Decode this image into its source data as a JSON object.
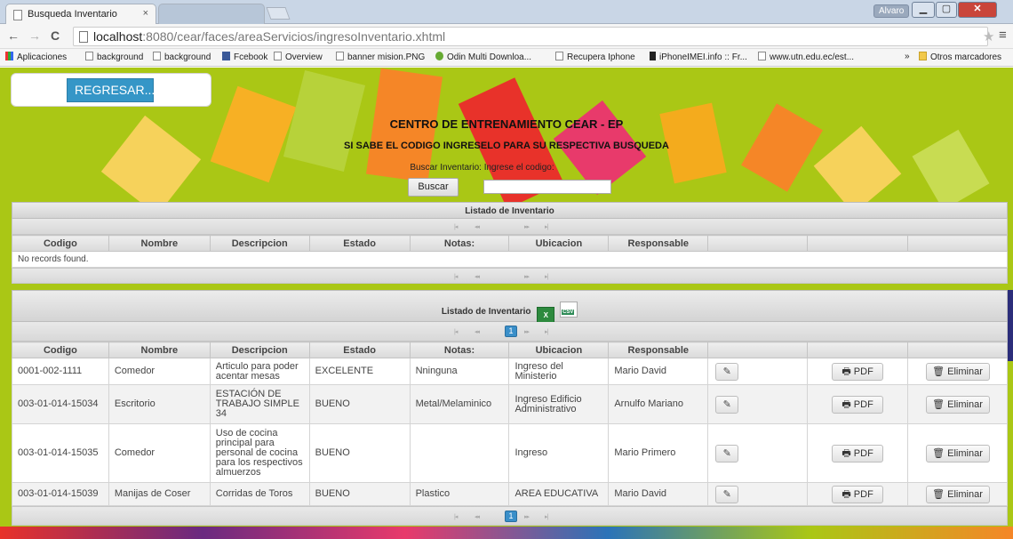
{
  "browser": {
    "tab_title": "Busqueda Inventario",
    "tab_close": "×",
    "user": "Alvaro",
    "url_host": "localhost",
    "url_path": ":8080/cear/faces/areaServicios/ingresoInventario.xhtml",
    "bookmarks": [
      "Aplicaciones",
      "background",
      "background",
      "Fcebook",
      "Overview",
      "banner mision.PNG",
      "Odin Multi Downloa...",
      "Recupera Iphone",
      "iPhoneIMEI.info :: Fr...",
      "www.utn.edu.ec/est..."
    ],
    "more_bookmarks": "»",
    "other_bookmarks": "Otros marcadores"
  },
  "page": {
    "back_button": "REGRESAR...",
    "title": "CENTRO DE ENTRENAMIENTO CEAR - EP",
    "subtitle": "SI SABE EL CODIGO INGRESELO PARA SU RESPECTIVA BUSQUEDA",
    "search_label": "Buscar Inventario: Ingrese el codigo:",
    "search_button": "Buscar",
    "search_value": ""
  },
  "pager": {
    "first": "|◂",
    "prev": "◂◂",
    "next": "▸▸",
    "last": "▸|",
    "page": "1"
  },
  "table1": {
    "title": "Listado de Inventario",
    "columns": [
      "Codigo",
      "Nombre",
      "Descripcion",
      "Estado",
      "Notas:",
      "Ubicacion",
      "Responsable",
      "",
      "",
      ""
    ],
    "empty": "No records found."
  },
  "table2": {
    "title": "Listado de Inventario",
    "export_xls": "X",
    "export_csv": "CSV",
    "columns": [
      "Codigo",
      "Nombre",
      "Descripcion",
      "Estado",
      "Notas:",
      "Ubicacion",
      "Responsable",
      "",
      "",
      ""
    ],
    "edit_icon": "✎",
    "pdf_label": "PDF",
    "pdf_icon": "🖶",
    "delete_label": "Eliminar",
    "delete_icon": "🗑",
    "rows": [
      {
        "codigo": "0001-002-1111",
        "nombre": "Comedor",
        "descripcion": "Articulo para poder acentar mesas",
        "estado": "EXCELENTE",
        "notas": "Nninguna",
        "ubicacion": "Ingreso del Ministerio",
        "responsable": "Mario David"
      },
      {
        "codigo": "003-01-014-15034",
        "nombre": "Escritorio",
        "descripcion": "ESTACIÓN DE TRABAJO SIMPLE 34",
        "estado": "BUENO",
        "notas": "Metal/Melaminico",
        "ubicacion": "Ingreso Edificio Administrativo",
        "responsable": "Arnulfo Mariano"
      },
      {
        "codigo": "003-01-014-15035",
        "nombre": "Comedor",
        "descripcion": "Uso de cocina principal para personal de cocina para los respectivos almuerzos",
        "estado": "BUENO",
        "notas": "",
        "ubicacion": "Ingreso",
        "responsable": "Mario Primero"
      },
      {
        "codigo": "003-01-014-15039",
        "nombre": "Manijas de Coser",
        "descripcion": "Corridas de Toros",
        "estado": "BUENO",
        "notas": "Plastico",
        "ubicacion": "AREA EDUCATIVA",
        "responsable": "Mario David"
      }
    ]
  },
  "colors": {
    "page_bg": "#aac715",
    "accent": "#3596c7"
  }
}
